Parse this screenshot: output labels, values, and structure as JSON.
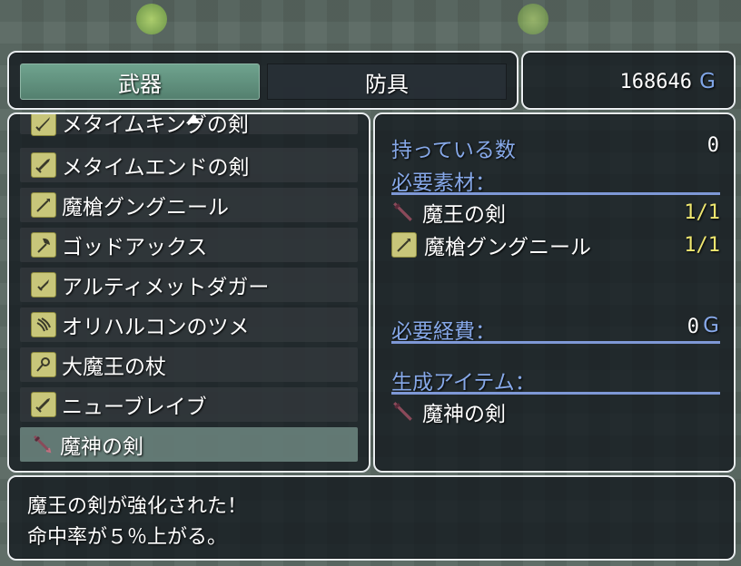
{
  "tabs": [
    {
      "label": "武器",
      "active": true
    },
    {
      "label": "防具",
      "active": false
    }
  ],
  "gold": {
    "amount": "168646",
    "unit": "G"
  },
  "item_list": [
    {
      "label": "メタイムキングの剣",
      "icon": "sword-icon",
      "partial": true
    },
    {
      "label": "メタイムエンドの剣",
      "icon": "sword-icon"
    },
    {
      "label": "魔槍グングニール",
      "icon": "spear-icon"
    },
    {
      "label": "ゴッドアックス",
      "icon": "axe-icon"
    },
    {
      "label": "アルティメットダガー",
      "icon": "dagger-icon"
    },
    {
      "label": "オリハルコンのツメ",
      "icon": "claw-icon"
    },
    {
      "label": "大魔王の杖",
      "icon": "staff-icon"
    },
    {
      "label": "ニューブレイブ",
      "icon": "sword-icon"
    },
    {
      "label": "魔神の剣",
      "icon": "dark-sword-icon",
      "selected": true
    }
  ],
  "detail": {
    "owned_label": "持っている数",
    "owned_value": "0",
    "materials_label": "必要素材：",
    "materials": [
      {
        "name": "魔王の剣",
        "icon": "dark-sword-icon",
        "count": "1/1"
      },
      {
        "name": "魔槍グングニール",
        "icon": "spear-icon",
        "count": "1/1"
      }
    ],
    "cost_label": "必要経費：",
    "cost_value": "0",
    "cost_unit": "G",
    "result_label": "生成アイテム：",
    "result_item": {
      "name": "魔神の剣",
      "icon": "dark-sword-icon"
    }
  },
  "message": {
    "line1": "魔王の剣が強化された！",
    "line2": "命中率が５％上がる。"
  },
  "colors": {
    "system_text": "#86a8e8",
    "count_text": "#f0e870",
    "active_tab": "#6fa38e",
    "window_border": "#e8ecef"
  }
}
